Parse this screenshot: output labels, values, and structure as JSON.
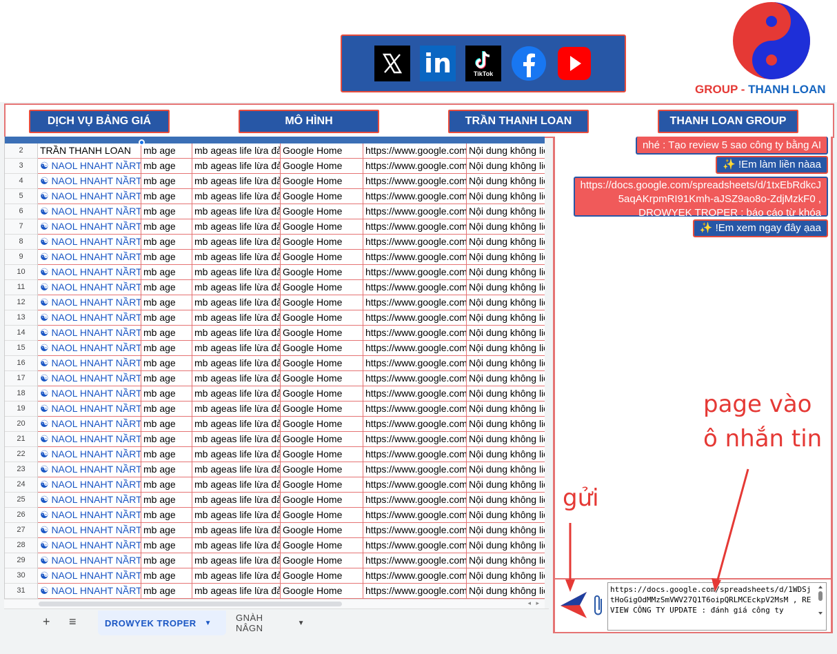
{
  "social": {
    "icons": [
      "x-icon",
      "linkedin-icon",
      "tiktok-icon",
      "facebook-icon",
      "youtube-icon"
    ],
    "tiktok_label": "TikTok",
    "linkedin_label": "in"
  },
  "logo": {
    "group": "GROUP",
    "dash": " - ",
    "name": "THANH LOAN"
  },
  "nav": {
    "b1": "DỊCH VỤ BẢNG GIÁ",
    "b2": "MÔ HÌNH",
    "b3": "TRẦN THANH LOAN",
    "b4": "THANH LOAN GROUP"
  },
  "sheet": {
    "first_row": {
      "num": "2",
      "c1": "TRẦN THANH LOAN",
      "c2": "mb age",
      "c3": "mb ageas life lừa đảo",
      "c4": "Google Home",
      "c5": "https://www.google.com",
      "c6": "Nội dung không liên"
    },
    "rows_numbers": [
      "3",
      "4",
      "5",
      "6",
      "7",
      "8",
      "9",
      "10",
      "11",
      "12",
      "13",
      "14",
      "15",
      "16",
      "17",
      "18",
      "19",
      "20",
      "21",
      "22",
      "23",
      "24",
      "25",
      "26",
      "27",
      "28",
      "29",
      "30",
      "31"
    ],
    "row_c1": "☯ NAOL HNAHT NẦRT",
    "row_c2": "mb age",
    "row_c3": "mb ageas life lừa đảo",
    "row_c4": "Google Home",
    "row_c5": "https://www.google.com",
    "row_c6": "Nội dung không liên",
    "tab_active": "DROWYEK TROPER",
    "tab_other": "GNÀH NÂGN"
  },
  "chat": {
    "m0": "nhé : Tạo review 5 sao công ty bằng AI",
    "m1": "✨ !Em làm liền nàaa",
    "m2a": "https://docs.google.com/spreadsheets/d/1txEbRdkcJ",
    "m2b": "5aqAKrpmRI91Kmh-aJSZ9ao8o-ZdjMzkF0 ,",
    "m2c": "DROWYEK TROPER : báo cáo từ khóa",
    "m3": "✨ !Em xem ngay đây ạaa",
    "input": "https://docs.google.com/spreadsheets/d/1WDSjtHoGigOdMMzSmVWV27Q1T6oipQRLMCEckpV2MsM , REVIEW CÔNG TY UPDATE : đánh giá công ty"
  },
  "annotations": {
    "send": "gửi",
    "paste1": "page vào",
    "paste2": "ô nhắn tin"
  },
  "colors": {
    "blue": "#2757a6",
    "red": "#e74c3c",
    "link": "#1a56c4"
  }
}
